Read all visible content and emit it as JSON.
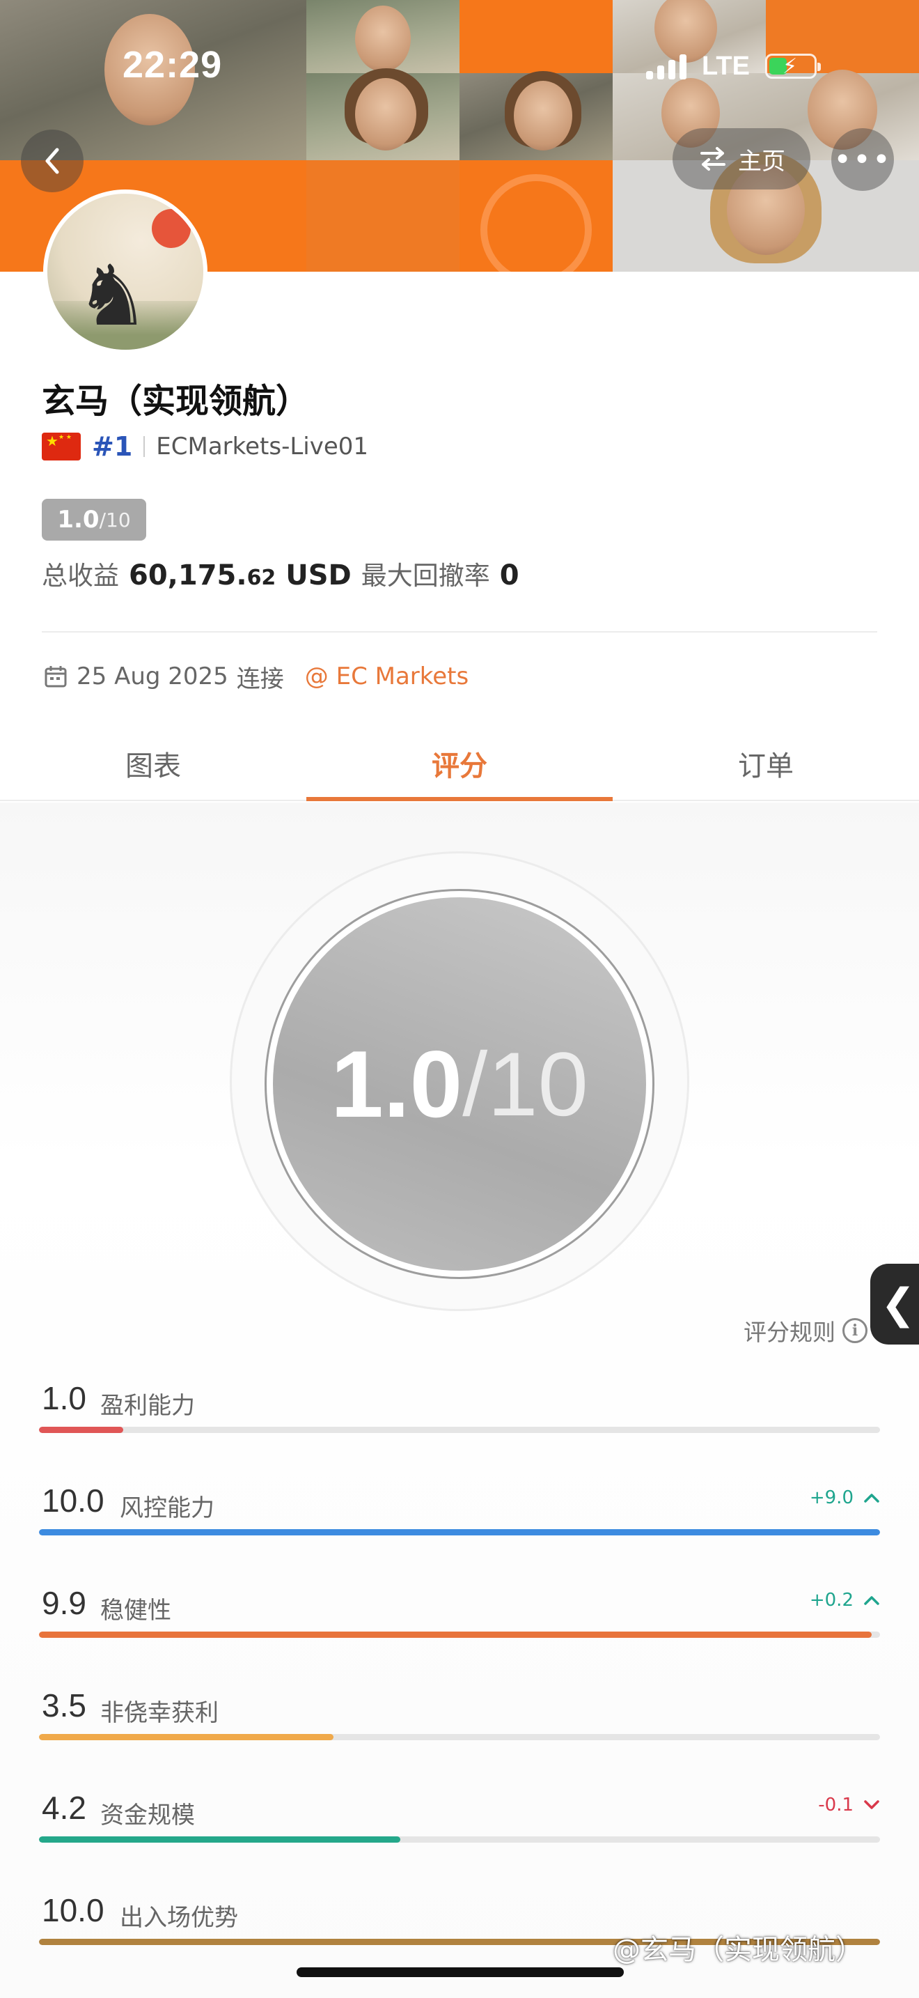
{
  "status_bar": {
    "time": "22:29",
    "network": "LTE"
  },
  "header": {
    "home_label": "主页",
    "more_icon": "more-dots-icon",
    "back_icon": "chevron-left-icon"
  },
  "profile": {
    "name": "玄马（实现领航）",
    "rank": "#1",
    "account": "ECMarkets-Live01",
    "score_badge": {
      "value": "1.0",
      "denominator": "/10"
    },
    "profit_label": "总收益",
    "profit_int": "60,175.",
    "profit_dec": "62",
    "profit_currency": "USD",
    "drawdown_label": "最大回撤率",
    "drawdown_value": "0",
    "connect_date": "25 Aug 2025",
    "connect_label": "连接",
    "broker": "@ EC Markets"
  },
  "tabs": [
    {
      "label": "图表",
      "active": false
    },
    {
      "label": "评分",
      "active": true
    },
    {
      "label": "订单",
      "active": false
    }
  ],
  "score": {
    "value": "1.0",
    "denominator": "/10"
  },
  "rules_label": "评分规则",
  "metrics": [
    {
      "value": "1.0",
      "label": "盈利能力",
      "delta": "",
      "direction": "",
      "fraction": 0.1,
      "color": "#e05656"
    },
    {
      "value": "10.0",
      "label": "风控能力",
      "delta": "+9.0",
      "direction": "up",
      "fraction": 1.0,
      "color": "#3c8be0"
    },
    {
      "value": "9.9",
      "label": "稳健性",
      "delta": "+0.2",
      "direction": "up",
      "fraction": 0.99,
      "color": "#e8743c"
    },
    {
      "value": "3.5",
      "label": "非侥幸获利",
      "delta": "",
      "direction": "",
      "fraction": 0.35,
      "color": "#f0a94a"
    },
    {
      "value": "4.2",
      "label": "资金规模",
      "delta": "-0.1",
      "direction": "down",
      "fraction": 0.43,
      "color": "#24a88a"
    },
    {
      "value": "10.0",
      "label": "出入场优势",
      "delta": "",
      "direction": "",
      "fraction": 1.0,
      "color": "#b0823f"
    }
  ],
  "watermark": "@玄马（实现领航）",
  "colors": {
    "accent": "#e8783a",
    "rank": "#2b55b8"
  }
}
